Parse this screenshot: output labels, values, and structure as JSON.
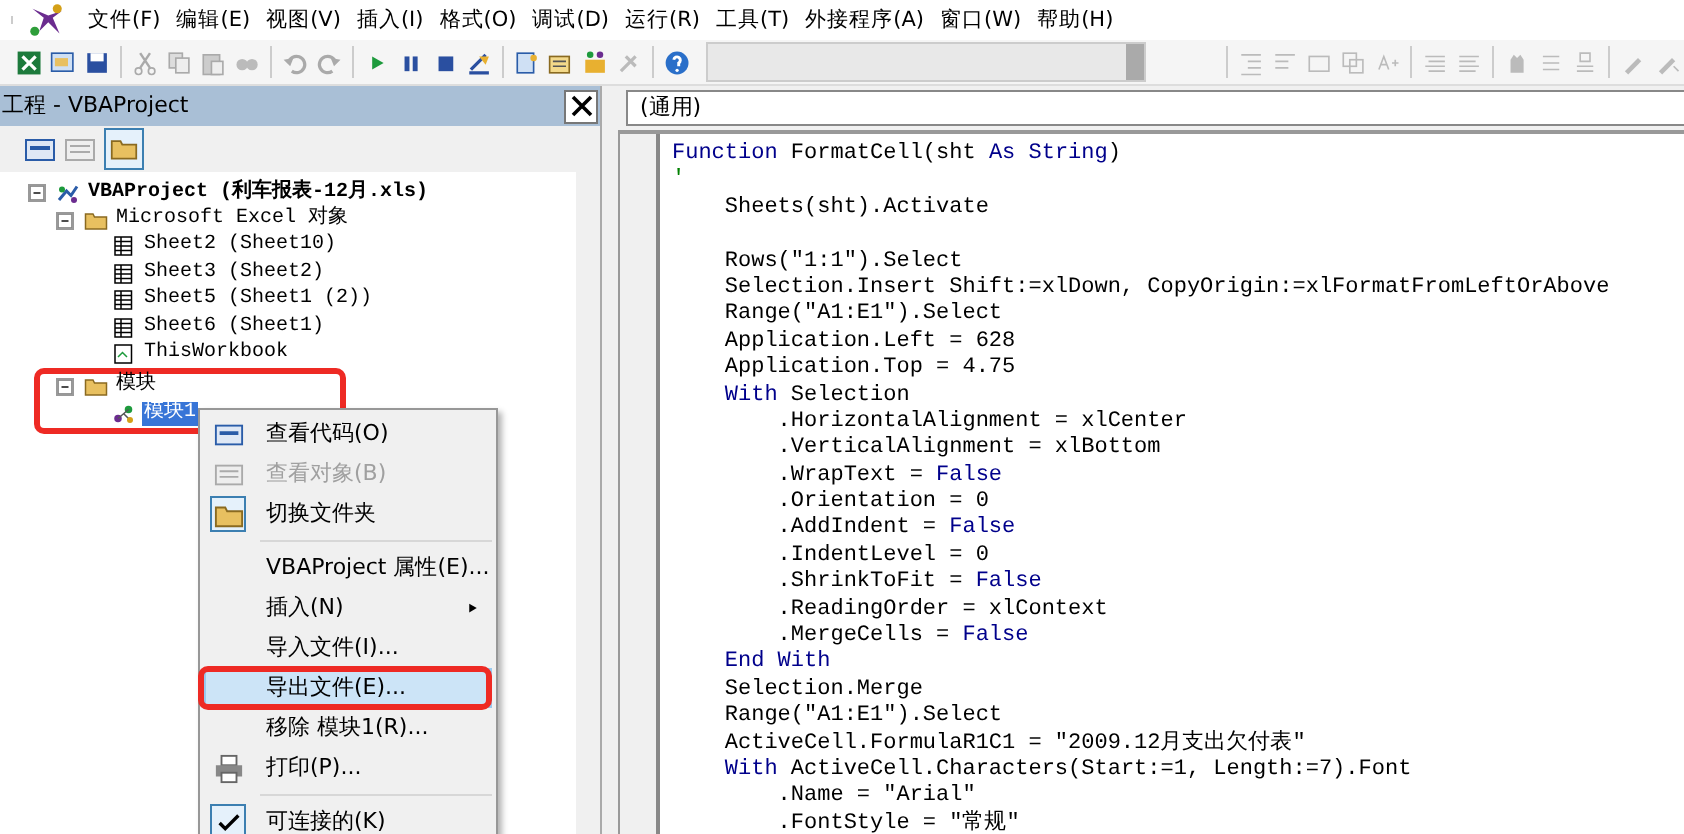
{
  "menu": [
    "文件(F)",
    "编辑(E)",
    "视图(V)",
    "插入(I)",
    "格式(O)",
    "调试(D)",
    "运行(R)",
    "工具(T)",
    "外接程序(A)",
    "窗口(W)",
    "帮助(H)"
  ],
  "project_panel": {
    "title": "工程 - VBAProject",
    "tree": [
      {
        "label": "VBAProject (利车报表-12月.xls)",
        "kind": "project",
        "expanded": true,
        "selected": false,
        "children": [
          {
            "label": "Microsoft Excel 对象",
            "kind": "folder",
            "expanded": true,
            "selected": false,
            "boxed": false,
            "children": [
              {
                "label": "Sheet2 (Sheet10)",
                "kind": "sheet",
                "selected": false
              },
              {
                "label": "Sheet3 (Sheet2)",
                "kind": "sheet",
                "selected": false
              },
              {
                "label": "Sheet5 (Sheet1 (2))",
                "kind": "sheet",
                "selected": false
              },
              {
                "label": "Sheet6 (Sheet1)",
                "kind": "sheet",
                "selected": false
              },
              {
                "label": "ThisWorkbook",
                "kind": "workbook",
                "selected": false
              }
            ]
          },
          {
            "label": "模块",
            "kind": "folder",
            "expanded": true,
            "selected": false,
            "boxed": true,
            "children": [
              {
                "label": "模块1",
                "kind": "module",
                "selected": true
              }
            ]
          }
        ]
      }
    ]
  },
  "code_window": {
    "object_box": "(通用)",
    "lines": [
      {
        "kind": "code",
        "segments": [
          {
            "text": "Function",
            "kind": "keyword"
          },
          {
            "text": " FormatCell(sht ",
            "kind": "plain"
          },
          {
            "text": "As ",
            "kind": "keyword"
          },
          {
            "text": "String",
            "kind": "keyword"
          },
          {
            "text": ")",
            "kind": "plain"
          }
        ]
      },
      {
        "kind": "code",
        "segments": [
          {
            "text": "'",
            "kind": "comment"
          }
        ]
      },
      {
        "kind": "code",
        "segments": [
          {
            "text": "    Sheets(sht).Activate",
            "kind": "plain"
          }
        ]
      },
      {
        "kind": "blank"
      },
      {
        "kind": "code",
        "segments": [
          {
            "text": "    Rows(\"1:1\").Select",
            "kind": "plain"
          }
        ]
      },
      {
        "kind": "code",
        "segments": [
          {
            "text": "    Selection.Insert Shift:=xlDown, CopyOrigin:=xlFormatFromLeftOrAbove",
            "kind": "plain"
          }
        ]
      },
      {
        "kind": "code",
        "segments": [
          {
            "text": "    Range(\"A1:E1\").Select",
            "kind": "plain"
          }
        ]
      },
      {
        "kind": "code",
        "segments": [
          {
            "text": "    Application.Left = 628",
            "kind": "plain"
          }
        ]
      },
      {
        "kind": "code",
        "segments": [
          {
            "text": "    Application.Top = 4.75",
            "kind": "plain"
          }
        ]
      },
      {
        "kind": "code",
        "segments": [
          {
            "text": "    With",
            "kind": "keyword"
          },
          {
            "text": " Selection",
            "kind": "plain"
          }
        ]
      },
      {
        "kind": "code",
        "segments": [
          {
            "text": "        .HorizontalAlignment = xlCenter",
            "kind": "plain"
          }
        ]
      },
      {
        "kind": "code",
        "segments": [
          {
            "text": "        .VerticalAlignment = xlBottom",
            "kind": "plain"
          }
        ]
      },
      {
        "kind": "code",
        "segments": [
          {
            "text": "        .WrapText = ",
            "kind": "plain"
          },
          {
            "text": "False",
            "kind": "keyword"
          }
        ]
      },
      {
        "kind": "code",
        "segments": [
          {
            "text": "        .Orientation = 0",
            "kind": "plain"
          }
        ]
      },
      {
        "kind": "code",
        "segments": [
          {
            "text": "        .AddIndent = ",
            "kind": "plain"
          },
          {
            "text": "False",
            "kind": "keyword"
          }
        ]
      },
      {
        "kind": "code",
        "segments": [
          {
            "text": "        .IndentLevel = 0",
            "kind": "plain"
          }
        ]
      },
      {
        "kind": "code",
        "segments": [
          {
            "text": "        .ShrinkToFit = ",
            "kind": "plain"
          },
          {
            "text": "False",
            "kind": "keyword"
          }
        ]
      },
      {
        "kind": "code",
        "segments": [
          {
            "text": "        .ReadingOrder = xlContext",
            "kind": "plain"
          }
        ]
      },
      {
        "kind": "code",
        "segments": [
          {
            "text": "        .MergeCells = ",
            "kind": "plain"
          },
          {
            "text": "False",
            "kind": "keyword"
          }
        ]
      },
      {
        "kind": "code",
        "segments": [
          {
            "text": "    End With",
            "kind": "keyword"
          }
        ]
      },
      {
        "kind": "code",
        "segments": [
          {
            "text": "    Selection.Merge",
            "kind": "plain"
          }
        ]
      },
      {
        "kind": "code",
        "segments": [
          {
            "text": "    Range(\"A1:E1\").Select",
            "kind": "plain"
          }
        ]
      },
      {
        "kind": "code",
        "segments": [
          {
            "text": "    ActiveCell.FormulaR1C1 = \"2009.12月支出欠付表\"",
            "kind": "plain"
          }
        ]
      },
      {
        "kind": "code",
        "segments": [
          {
            "text": "    With",
            "kind": "keyword"
          },
          {
            "text": " ActiveCell.Characters(Start:=1, Length:=7).Font",
            "kind": "plain"
          }
        ]
      },
      {
        "kind": "code",
        "segments": [
          {
            "text": "        .Name = \"Arial\"",
            "kind": "plain"
          }
        ]
      },
      {
        "kind": "code",
        "segments": [
          {
            "text": "        .FontStyle = \"常规\"",
            "kind": "plain"
          }
        ]
      }
    ]
  },
  "context_menu": {
    "items": [
      {
        "kind": "item",
        "label": "查看代码(O)",
        "disabled": false,
        "highlighted": false,
        "checked": false,
        "submenu": false
      },
      {
        "kind": "item",
        "label": "查看对象(B)",
        "disabled": true,
        "highlighted": false,
        "checked": false,
        "submenu": false
      },
      {
        "kind": "item",
        "label": "切换文件夹",
        "disabled": false,
        "highlighted": false,
        "checked": true,
        "submenu": false
      },
      {
        "kind": "separator"
      },
      {
        "kind": "item",
        "label": "VBAProject 属性(E)...",
        "disabled": false,
        "highlighted": false,
        "checked": false,
        "submenu": false
      },
      {
        "kind": "item",
        "label": "插入(N)",
        "disabled": false,
        "highlighted": false,
        "checked": false,
        "submenu": true
      },
      {
        "kind": "item",
        "label": "导入文件(I)...",
        "disabled": false,
        "highlighted": false,
        "checked": false,
        "submenu": false
      },
      {
        "kind": "item",
        "label": "导出文件(E)...",
        "disabled": false,
        "highlighted": true,
        "checked": false,
        "submenu": false,
        "boxed": true
      },
      {
        "kind": "item",
        "label": "移除 模块1(R)...",
        "disabled": false,
        "highlighted": false,
        "checked": false,
        "submenu": false
      },
      {
        "kind": "item",
        "label": "打印(P)...",
        "disabled": false,
        "highlighted": false,
        "checked": false,
        "submenu": false
      },
      {
        "kind": "separator"
      },
      {
        "kind": "item",
        "label": "可连接的(K)",
        "disabled": false,
        "highlighted": false,
        "checked": true,
        "submenu": false
      }
    ]
  }
}
